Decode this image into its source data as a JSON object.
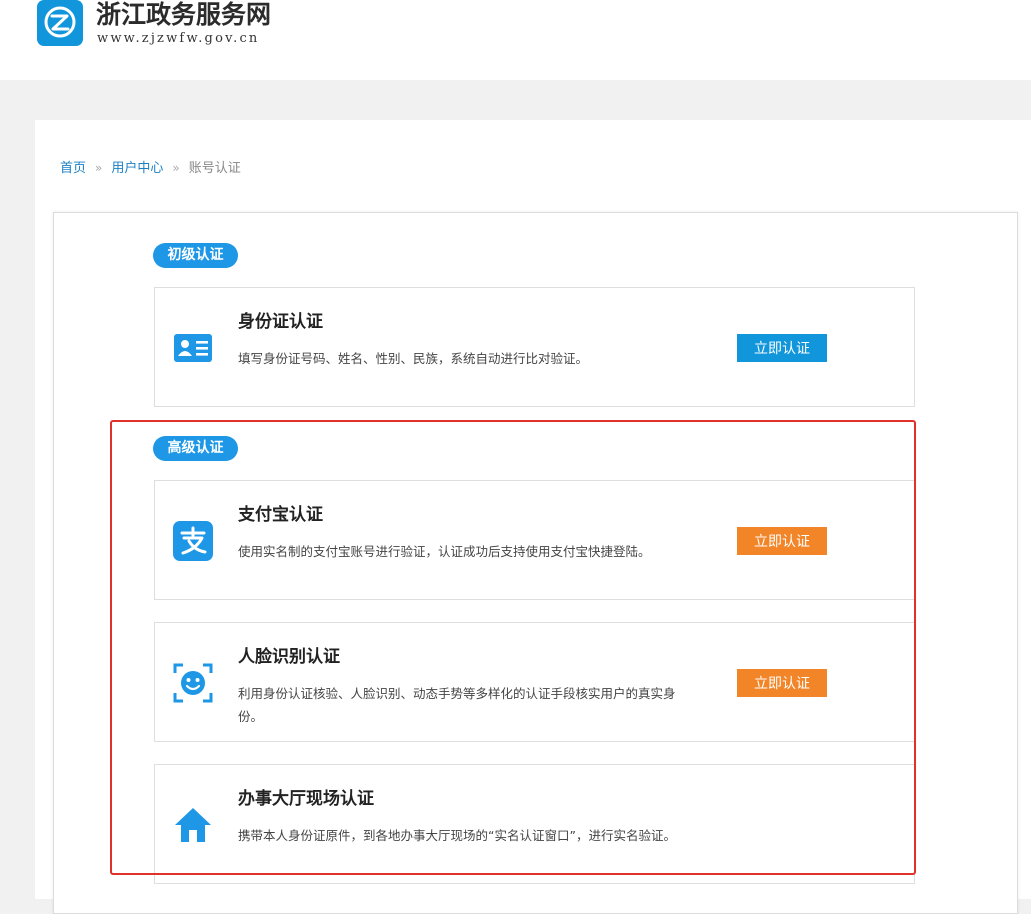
{
  "site": {
    "name": "浙江政务服务网",
    "url": "www.zjzwfw.gov.cn"
  },
  "breadcrumb": {
    "home": "首页",
    "user_center": "用户中心",
    "separator": "»",
    "current": "账号认证"
  },
  "levels": {
    "basic": "初级认证",
    "advanced": "高级认证"
  },
  "cards": {
    "id_card": {
      "title": "身份证认证",
      "desc": "填写身份证号码、姓名、性别、民族，系统自动进行比对验证。",
      "button": "立即认证",
      "icon": "id-card-icon"
    },
    "alipay": {
      "title": "支付宝认证",
      "desc": "使用实名制的支付宝账号进行验证，认证成功后支持使用支付宝快捷登陆。",
      "button": "立即认证",
      "icon": "alipay-icon"
    },
    "face": {
      "title": "人脸识别认证",
      "desc": "利用身份认证核验、人脸识别、动态手势等多样化的认证手段核实用户的真实身份。",
      "button": "立即认证",
      "icon": "face-scan-icon"
    },
    "hall": {
      "title": "办事大厅现场认证",
      "desc": "携带本人身份证原件，到各地办事大厅现场的“实名认证窗口”，进行实名验证。",
      "icon": "home-icon"
    }
  },
  "colors": {
    "accent_blue": "#1296db",
    "badge_blue": "#1d97e6",
    "button_orange": "#f18528",
    "highlight_red": "#e0312b"
  }
}
